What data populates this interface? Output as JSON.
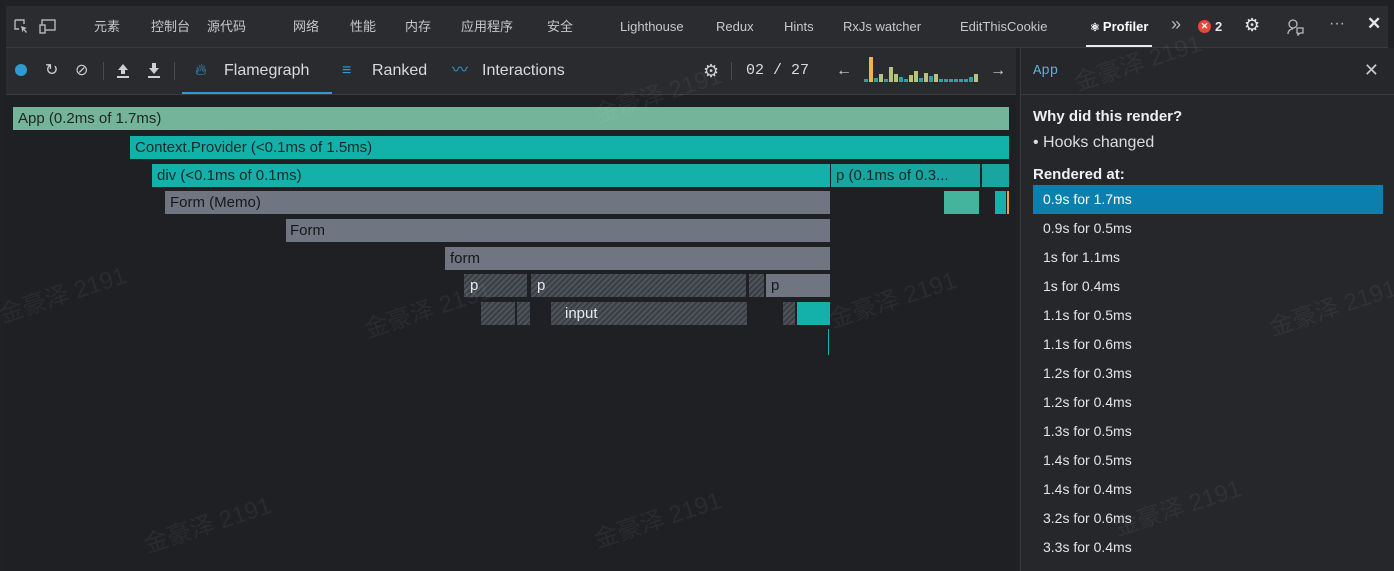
{
  "devtools_tabs": [
    "元素",
    "控制台",
    "源代码",
    "网络",
    "性能",
    "内存",
    "应用程序",
    "安全",
    "Lighthouse",
    "Redux",
    "Hints",
    "RxJs watcher",
    "EditThisCookie",
    "Profiler"
  ],
  "active_tab": "Profiler",
  "error_count": "2",
  "toolbar": {
    "flamegraph_label": "Flamegraph",
    "ranked_label": "Ranked",
    "interactions_label": "Interactions",
    "commit_counter": "02 / 27",
    "commit_bars": [
      0.12,
      0.9,
      0.14,
      0.3,
      0.1,
      0.55,
      0.3,
      0.18,
      0.1,
      0.25,
      0.4,
      0.15,
      0.32,
      0.2,
      0.28,
      0.12,
      0.12,
      0.12,
      0.12,
      0.12,
      0.12,
      0.18,
      0.3
    ],
    "commit_selected_index": 1
  },
  "flame": {
    "bars": [
      {
        "label": "App (0.2ms of 1.7ms)"
      },
      {
        "label": "Context.Provider (<0.1ms of 1.5ms)"
      },
      {
        "label": "div (<0.1ms of 0.1ms)"
      },
      {
        "label": "p (0.1ms of 0.3..."
      },
      {
        "label": "Form (Memo)"
      },
      {
        "label": "Form"
      },
      {
        "label": "form"
      },
      {
        "label": "p"
      },
      {
        "label": "p"
      },
      {
        "label": "p"
      },
      {
        "label": "input"
      }
    ]
  },
  "panel": {
    "title": "App",
    "why_heading": "Why did this render?",
    "reason": "• Hooks changed",
    "rendered_heading": "Rendered at:",
    "rendered_at": [
      "0.9s for 1.7ms",
      "0.9s for 0.5ms",
      "1s for 1.1ms",
      "1s for 0.4ms",
      "1.1s for 0.5ms",
      "1.1s for 0.6ms",
      "1.2s for 0.3ms",
      "1.2s for 0.4ms",
      "1.3s for 0.5ms",
      "1.4s for 0.5ms",
      "1.4s for 0.4ms",
      "3.2s for 0.6ms",
      "3.3s for 0.4ms"
    ],
    "selected_index": 0
  },
  "watermark": "金豪泽 2191",
  "colors": {
    "accent": "#0b7fad",
    "flame_green": "#74b49a",
    "flame_teal": "#14b1aa",
    "flame_gray": "#6f7682",
    "commit_selected": "#f1b34a",
    "error": "#e8453c",
    "flamegraph_icon": "#2f9bd4"
  }
}
